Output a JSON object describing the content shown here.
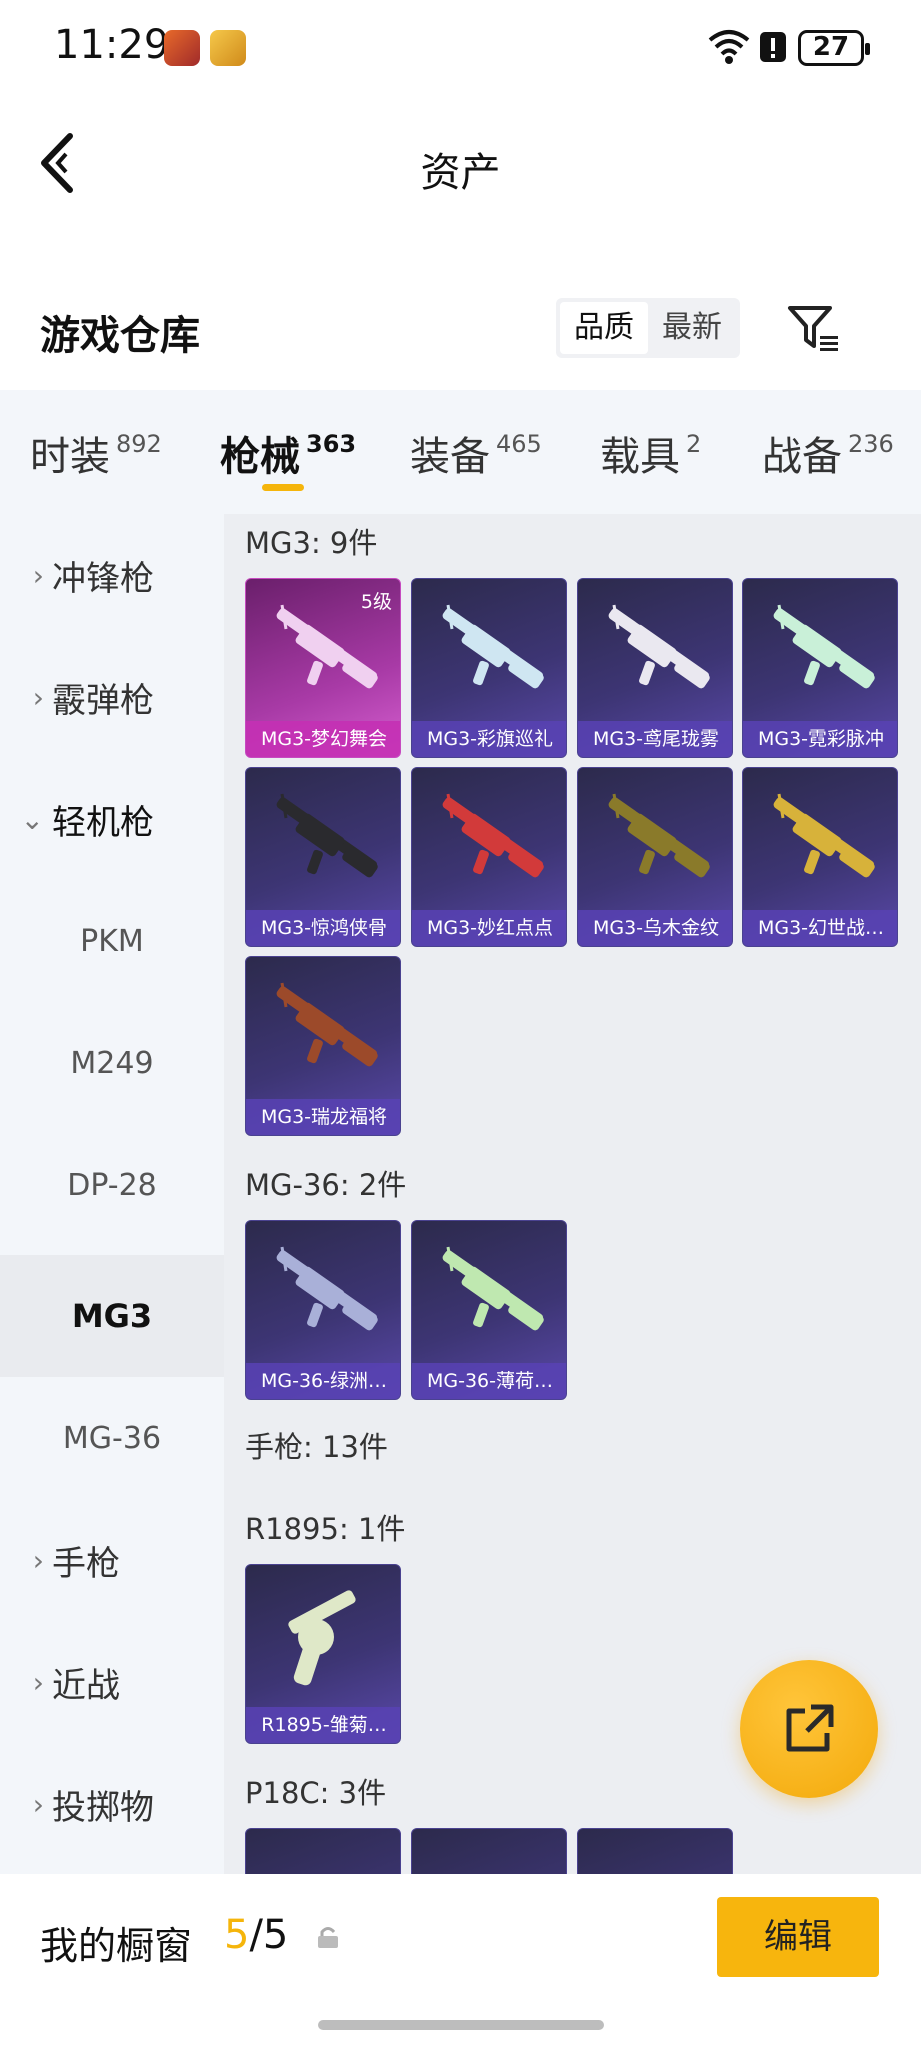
{
  "status_bar": {
    "time": "11:29",
    "battery": "27"
  },
  "header": {
    "title": "资产"
  },
  "warehouse": {
    "title": "游戏仓库",
    "sort_options": [
      "品质",
      "最新"
    ],
    "active_sort": "品质"
  },
  "tabs": [
    {
      "label": "时装",
      "count": "892"
    },
    {
      "label": "枪械",
      "count": "363"
    },
    {
      "label": "装备",
      "count": "465"
    },
    {
      "label": "载具",
      "count": "2"
    },
    {
      "label": "战备",
      "count": "236"
    }
  ],
  "active_tab": "枪械",
  "sidebar": [
    {
      "label": "冲锋枪",
      "type": "category"
    },
    {
      "label": "霰弹枪",
      "type": "category"
    },
    {
      "label": "轻机枪",
      "type": "category-open"
    },
    {
      "label": "PKM",
      "type": "sub"
    },
    {
      "label": "M249",
      "type": "sub"
    },
    {
      "label": "DP-28",
      "type": "sub"
    },
    {
      "label": "MG3",
      "type": "sub-selected"
    },
    {
      "label": "MG-36",
      "type": "sub"
    },
    {
      "label": "手枪",
      "type": "category"
    },
    {
      "label": "近战",
      "type": "category"
    },
    {
      "label": "投掷物",
      "type": "category"
    }
  ],
  "groups": {
    "mg3": {
      "label": "MG3: 9件",
      "items": [
        {
          "name": "MG3-梦幻舞会",
          "level": "5级",
          "rarity": "legendary",
          "color": "#f0d0f0"
        },
        {
          "name": "MG3-彩旗巡礼",
          "color": "#cfe6f2"
        },
        {
          "name": "MG3-鸢尾珑雾",
          "color": "#eae8f0"
        },
        {
          "name": "MG3-霓彩脉冲",
          "color": "#c9f0d8"
        },
        {
          "name": "MG3-惊鸿侠骨",
          "color": "#2a2a2e"
        },
        {
          "name": "MG3-妙红点点",
          "color": "#d23a3a"
        },
        {
          "name": "MG3-乌木金纹",
          "color": "#8a7a2a"
        },
        {
          "name": "MG3-幻世战…",
          "color": "#d7b23a"
        },
        {
          "name": "MG3-瑞龙福将",
          "color": "#9c4a2a"
        }
      ]
    },
    "mg36": {
      "label": "MG-36: 2件",
      "items": [
        {
          "name": "MG-36-绿洲…",
          "color": "#a9b0d8"
        },
        {
          "name": "MG-36-薄荷…",
          "color": "#bfe8b0"
        }
      ]
    },
    "pistol": {
      "label": "手枪: 13件"
    },
    "r1895": {
      "label": "R1895: 1件",
      "items": [
        {
          "name": "R1895-雏菊…",
          "color": "#dfe8c8"
        }
      ]
    },
    "p18c": {
      "label": "P18C: 3件"
    }
  },
  "showcase": {
    "label": "我的橱窗",
    "current": "5",
    "total": "/5",
    "edit_label": "编辑"
  }
}
